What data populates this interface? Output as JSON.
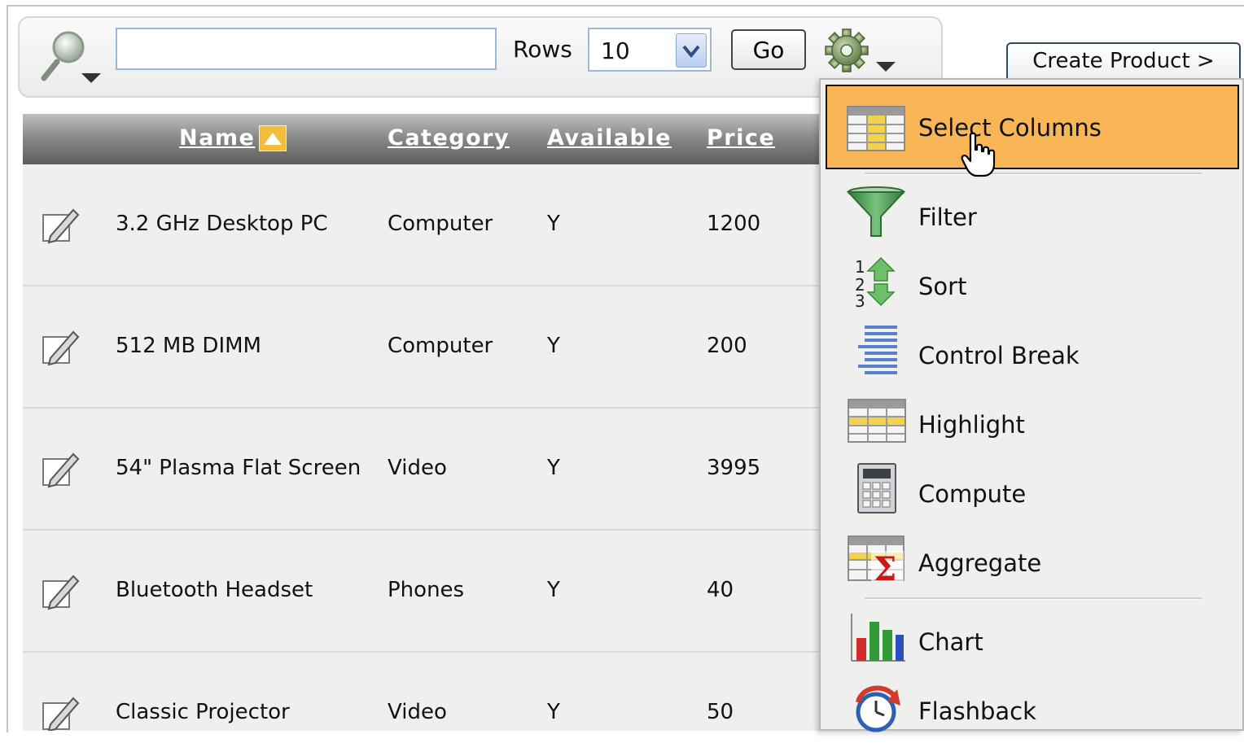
{
  "toolbar": {
    "search_value": "",
    "rows_label": "Rows",
    "rows_value": "10",
    "go_label": "Go",
    "create_label": "Create Product >"
  },
  "report": {
    "columns": [
      "Name",
      "Category",
      "Available",
      "Price"
    ],
    "sorted_column": "Name",
    "sort_direction": "ascending",
    "rows": [
      {
        "name": "3.2 GHz Desktop PC",
        "category": "Computer",
        "available": "Y",
        "price": "1200"
      },
      {
        "name": "512 MB DIMM",
        "category": "Computer",
        "available": "Y",
        "price": "200"
      },
      {
        "name": "54\" Plasma Flat Screen",
        "category": "Video",
        "available": "Y",
        "price": "3995"
      },
      {
        "name": "Bluetooth Headset",
        "category": "Phones",
        "available": "Y",
        "price": "40"
      },
      {
        "name": "Classic Projector",
        "category": "Video",
        "available": "Y",
        "price": "50"
      }
    ]
  },
  "actions_menu": {
    "items": [
      {
        "label": "Select Columns",
        "icon": "select-columns-icon",
        "highlighted": true
      },
      {
        "label": "Filter",
        "icon": "funnel-icon"
      },
      {
        "label": "Sort",
        "icon": "sort-icon"
      },
      {
        "label": "Control Break",
        "icon": "control-break-icon"
      },
      {
        "label": "Highlight",
        "icon": "highlight-icon"
      },
      {
        "label": "Compute",
        "icon": "calculator-icon"
      },
      {
        "label": "Aggregate",
        "icon": "sigma-icon"
      },
      {
        "label": "Chart",
        "icon": "bar-chart-icon"
      },
      {
        "label": "Flashback",
        "icon": "clock-arrow-icon"
      }
    ]
  },
  "colors": {
    "highlight": "#f8b657",
    "header_dark": "#5d5d5d",
    "row_bg": "#efefee",
    "input_border": "#9fb7d7"
  }
}
